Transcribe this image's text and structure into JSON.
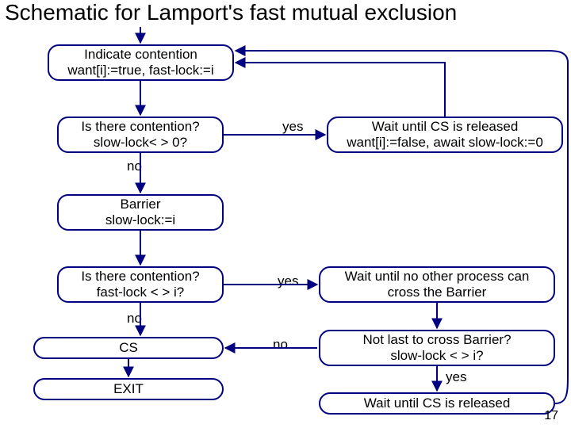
{
  "title": "Schematic for Lamport's fast mutual exclusion",
  "nodes": {
    "indicate": {
      "line1": "Indicate contention",
      "line2": "want[i]:=true, fast-lock:=i"
    },
    "check1": {
      "line1": "Is there contention?",
      "line2": "slow-lock< > 0?"
    },
    "wait1": {
      "line1": "Wait until CS is released",
      "line2": "want[i]:=false, await slow-lock:=0"
    },
    "barrier": {
      "line1": "Barrier",
      "line2": "slow-lock:=i"
    },
    "check2": {
      "line1": "Is there contention?",
      "line2": "fast-lock < > i?"
    },
    "wait2": {
      "line1": "Wait until no other process can",
      "line2": "cross the Barrier"
    },
    "cs": {
      "line1": "CS"
    },
    "notlast": {
      "line1": "Not last to cross Barrier?",
      "line2": "slow-lock < > i?"
    },
    "exit": {
      "line1": "EXIT"
    },
    "wait3": {
      "line1": "Wait until CS is released"
    }
  },
  "labels": {
    "yes1": "yes",
    "no1": "no",
    "yes2": "yes",
    "no2": "no",
    "no3": "no",
    "yes3": "yes"
  },
  "pagenum": "17"
}
